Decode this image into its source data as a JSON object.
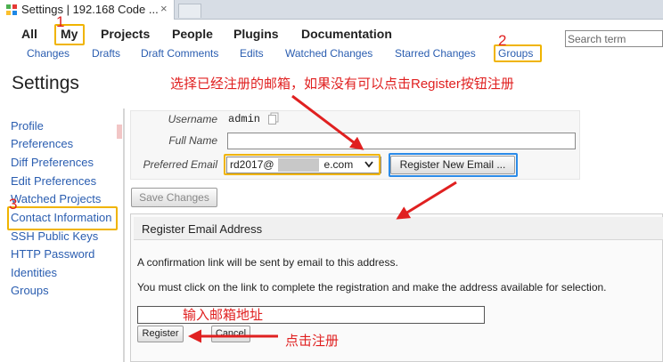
{
  "browser": {
    "tab_title": "Settings | 192.168 Code ...",
    "close_glyph": "×"
  },
  "menu": {
    "items": [
      "All",
      "My",
      "Projects",
      "People",
      "Plugins",
      "Documentation"
    ],
    "search_placeholder": "Search term"
  },
  "submenu": {
    "items": [
      "Changes",
      "Drafts",
      "Draft Comments",
      "Edits",
      "Watched Changes",
      "Starred Changes",
      "Groups"
    ]
  },
  "page": {
    "title": "Settings"
  },
  "sidebar": {
    "items": [
      "Profile",
      "Preferences",
      "Diff Preferences",
      "Edit Preferences",
      "Watched Projects",
      "Contact Information",
      "SSH Public Keys",
      "HTTP Password",
      "Identities",
      "Groups"
    ]
  },
  "form": {
    "username_label": "Username",
    "username_value": "admin",
    "fullname_label": "Full Name",
    "fullname_value": "",
    "email_label": "Preferred Email",
    "email_prefix": "rd2017@",
    "email_suffix": "e.com",
    "register_new_email_label": "Register New Email ...",
    "save_changes_label": "Save Changes"
  },
  "dialog": {
    "title": "Register Email Address",
    "line1": "A confirmation link will be sent by email to this address.",
    "line2": "You must click on the link to complete the registration and make the address available for selection.",
    "email_input_value": "",
    "register_label": "Register",
    "cancel_label": "Cancel"
  },
  "annotations": {
    "num1": "1",
    "num2": "2",
    "num3": "3",
    "text_register_hint": "选择已经注册的邮箱，如果没有可以点击Register按钮注册",
    "text_input_hint": "输入邮箱地址",
    "text_click_register": "点击注册",
    "color_red": "#e02020",
    "color_orange": "#f0b400",
    "color_blue": "#2b8be8"
  }
}
